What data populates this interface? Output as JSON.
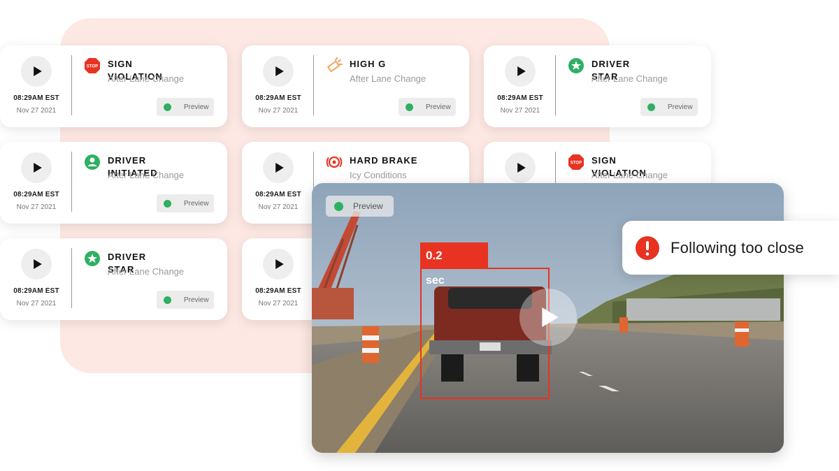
{
  "cards": [
    {
      "id": "c1",
      "time": "08:29AM EST",
      "date": "Nov 27 2021",
      "icon": "stop-sign-icon",
      "title": "SIGN VIOLATION",
      "subtitle": "After Lane Change",
      "preview": "Preview"
    },
    {
      "id": "c2",
      "time": "08:29AM EST",
      "date": "Nov 27 2021",
      "icon": "high-g-icon",
      "title": "HIGH G",
      "subtitle": "After Lane Change",
      "preview": "Preview"
    },
    {
      "id": "c3",
      "time": "08:29AM EST",
      "date": "Nov 27 2021",
      "icon": "star-icon",
      "title": "DRIVER STAR",
      "subtitle": "After Lane Change",
      "preview": "Preview"
    },
    {
      "id": "c4",
      "time": "08:29AM EST",
      "date": "Nov 27 2021",
      "icon": "driver-user-icon",
      "title": "DRIVER INITIATED",
      "subtitle": "After Lane Change",
      "preview": "Preview"
    },
    {
      "id": "c5",
      "time": "08:29AM EST",
      "date": "Nov 27 2021",
      "icon": "hard-brake-icon",
      "title": "HARD BRAKE",
      "subtitle": "Icy Conditions",
      "preview": ""
    },
    {
      "id": "c6",
      "time": "",
      "date": "",
      "icon": "stop-sign-icon",
      "title": "SIGN VIOLATION",
      "subtitle": "After Lane Change",
      "preview": ""
    },
    {
      "id": "c7",
      "time": "08:29AM EST",
      "date": "Nov 27 2021",
      "icon": "star-icon",
      "title": "DRIVER STAR",
      "subtitle": "After Lane Change",
      "preview": "Preview"
    },
    {
      "id": "c8",
      "time": "08:29AM EST",
      "date": "Nov 27 2021",
      "icon": "",
      "title": "",
      "subtitle": "",
      "preview": ""
    }
  ],
  "stop_sign_text": "STOP",
  "video": {
    "preview_label": "Preview",
    "detection_value": "0.2",
    "detection_unit": "sec"
  },
  "alert": {
    "text": "Following too close",
    "icon": "exclamation-circle-icon"
  },
  "colors": {
    "background_panel": "#fde8e3",
    "status_green": "#2eb062",
    "alert_red": "#e83222",
    "star_green": "#2eb062",
    "high_g_orange": "#f0a35a"
  }
}
